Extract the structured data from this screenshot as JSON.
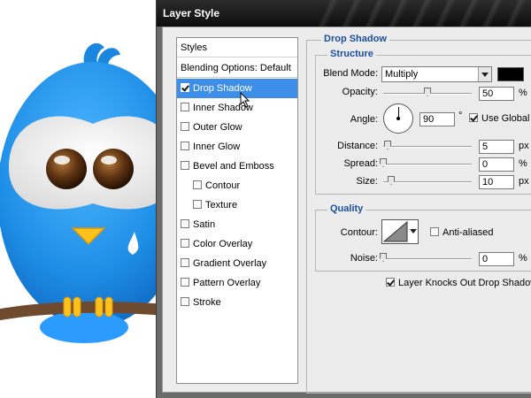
{
  "dialog": {
    "title": "Layer Style"
  },
  "style_list": {
    "header": "Styles",
    "blending": "Blending Options: Default",
    "items": [
      {
        "label": "Drop Shadow",
        "checked": true,
        "selected": true
      },
      {
        "label": "Inner Shadow",
        "checked": false
      },
      {
        "label": "Outer Glow",
        "checked": false
      },
      {
        "label": "Inner Glow",
        "checked": false
      },
      {
        "label": "Bevel and Emboss",
        "checked": false
      },
      {
        "label": "Contour",
        "checked": false
      },
      {
        "label": "Texture",
        "checked": false
      },
      {
        "label": "Satin",
        "checked": false
      },
      {
        "label": "Color Overlay",
        "checked": false
      },
      {
        "label": "Gradient Overlay",
        "checked": false
      },
      {
        "label": "Pattern Overlay",
        "checked": false
      },
      {
        "label": "Stroke",
        "checked": false
      }
    ]
  },
  "drop_shadow": {
    "section_title": "Drop Shadow",
    "structure": {
      "title": "Structure",
      "blend_mode_label": "Blend Mode:",
      "blend_mode_value": "Multiply",
      "shadow_color": "#000000",
      "opacity_label": "Opacity:",
      "opacity_value": "50",
      "opacity_unit": "%",
      "angle_label": "Angle:",
      "angle_value": "90",
      "angle_unit": "°",
      "global_light_label": "Use Global Light",
      "global_light_checked": true,
      "distance_label": "Distance:",
      "distance_value": "5",
      "distance_unit": "px",
      "spread_label": "Spread:",
      "spread_value": "0",
      "spread_unit": "%",
      "size_label": "Size:",
      "size_value": "10",
      "size_unit": "px"
    },
    "quality": {
      "title": "Quality",
      "contour_label": "Contour:",
      "anti_aliased_label": "Anti-aliased",
      "anti_aliased_checked": false,
      "noise_label": "Noise:",
      "noise_value": "0",
      "noise_unit": "%"
    },
    "knockout_label": "Layer Knocks Out Drop Shadow",
    "knockout_checked": true
  },
  "colors": {
    "selection": "#3d8ee8",
    "group_title": "#1c4fa0",
    "bird_blue": "#1e8ee6"
  }
}
